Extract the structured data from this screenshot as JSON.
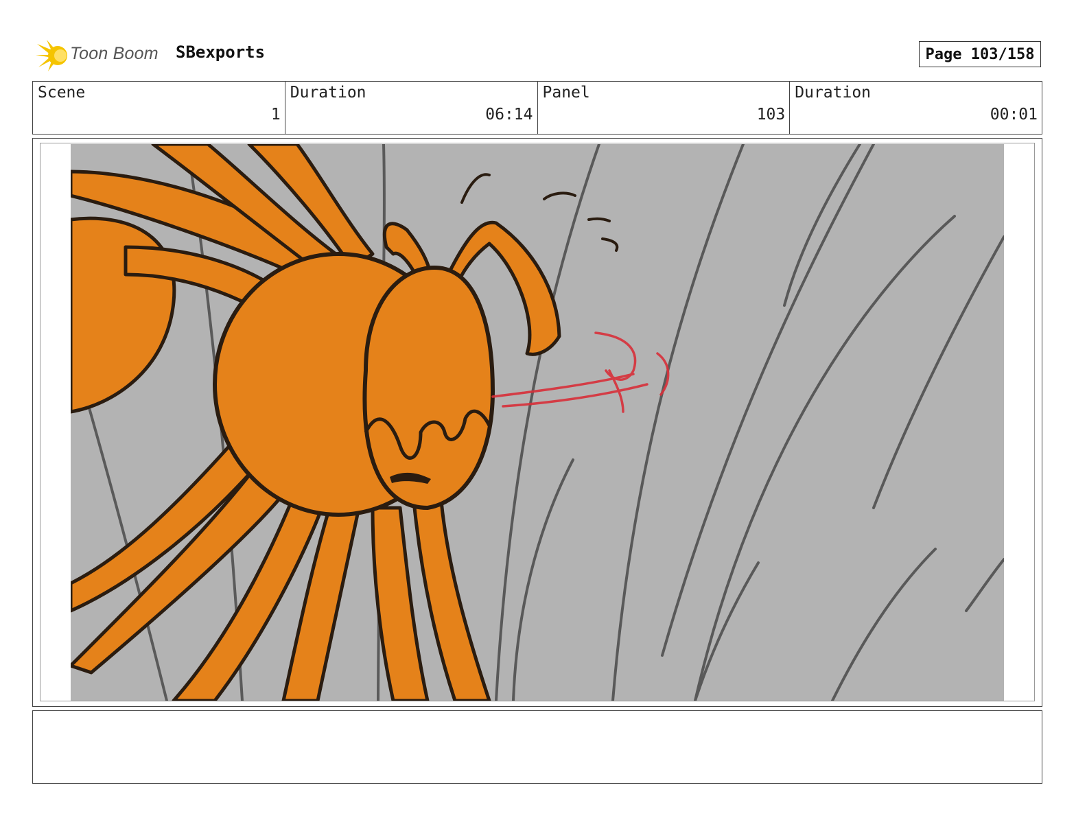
{
  "header": {
    "logo_text": "Toon Boom",
    "project_name": "SBexports",
    "page_label": "Page 103/158"
  },
  "info": {
    "scene_label": "Scene",
    "scene_value": "1",
    "scene_duration_label": "Duration",
    "scene_duration_value": "06:14",
    "panel_label": "Panel",
    "panel_value": "103",
    "panel_duration_label": "Duration",
    "panel_duration_value": "00:01"
  },
  "colors": {
    "character_orange": "#e5821a",
    "background_gray": "#b3b3b3",
    "line_dark": "#2a1c10",
    "red_sketch": "#d8303a",
    "logo_yellow": "#f5c400"
  },
  "notes": {
    "text": ""
  }
}
